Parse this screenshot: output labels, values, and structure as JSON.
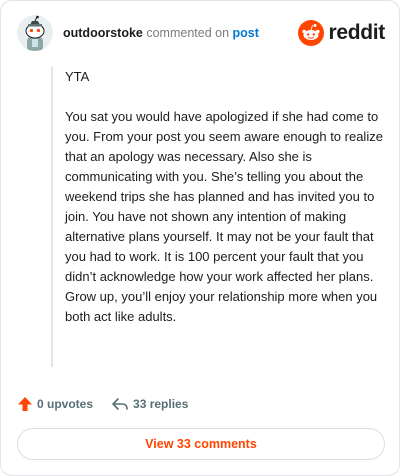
{
  "header": {
    "username": "outdoorstoke",
    "verb": "commented on",
    "target": "post",
    "brand": "reddit",
    "brand_color": "#ff4500"
  },
  "comment": {
    "paragraphs": [
      "YTA",
      "You sat you would have apologized if she had come to you. From your post you seem aware enough to realize that an apology was necessary. Also she is communicating with you. She’s telling you about the weekend trips she has planned and has invited you to join. You have not shown any intention of making alternative plans yourself. It may not be your fault that you had to work. It is 100 percent your fault that you didn’t acknowledge how your work affected her plans. Grow up, you’ll enjoy your relationship more when you both act like adults."
    ]
  },
  "actions": {
    "upvotes": "0 upvotes",
    "replies": "33 replies",
    "upvote_icon": "upvote-arrow-icon",
    "reply_icon": "reply-arrow-icon"
  },
  "footer": {
    "view_comments": "View 33 comments"
  }
}
